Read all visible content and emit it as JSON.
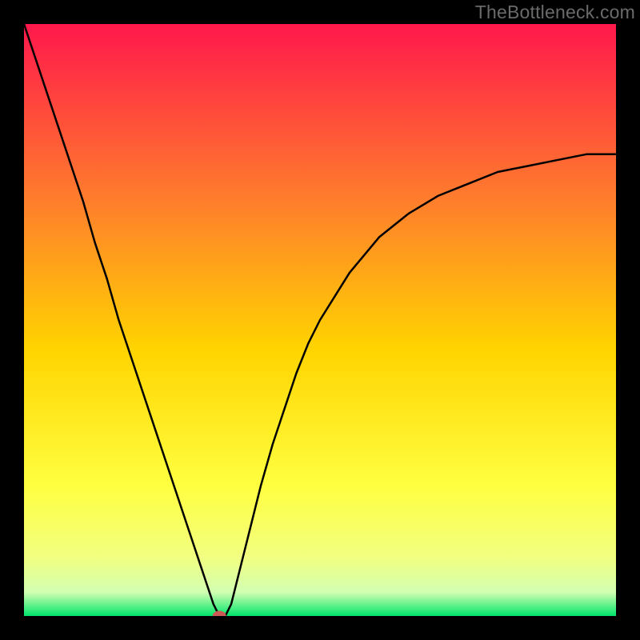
{
  "watermark": "TheBottleneck.com",
  "colors": {
    "frame": "#000000",
    "curve": "#000000",
    "marker_fill": "#cc5a55",
    "marker_stroke": "#cc5a55",
    "gradient": {
      "top": "#ff184b",
      "q1": "#ff7e2c",
      "mid": "#ffd400",
      "q3": "#ffff40",
      "q4": "#f2ff80",
      "low2": "#d2ffb2",
      "bottom": "#00e66a"
    }
  },
  "chart_data": {
    "type": "line",
    "x": [
      0,
      2,
      4,
      6,
      8,
      10,
      12,
      14,
      16,
      18,
      20,
      22,
      24,
      26,
      28,
      30,
      31,
      32,
      33,
      34,
      35,
      36,
      37,
      38,
      40,
      42,
      44,
      46,
      48,
      50,
      55,
      60,
      65,
      70,
      75,
      80,
      85,
      90,
      95,
      100
    ],
    "values": [
      100,
      94,
      88,
      82,
      76,
      70,
      63,
      57,
      50,
      44,
      38,
      32,
      26,
      20,
      14,
      8,
      5,
      2,
      0,
      0,
      2,
      6,
      10,
      14,
      22,
      29,
      35,
      41,
      46,
      50,
      58,
      64,
      68,
      71,
      73,
      75,
      76,
      77,
      78,
      78
    ],
    "series": [
      {
        "name": "bottleneck-curve",
        "color": "#000000"
      }
    ],
    "markers": [
      {
        "name": "optimal-point",
        "x": 33,
        "y": 0
      }
    ],
    "xlabel": "",
    "ylabel": "",
    "title": "",
    "xlim": [
      0,
      100
    ],
    "ylim": [
      0,
      100
    ]
  }
}
